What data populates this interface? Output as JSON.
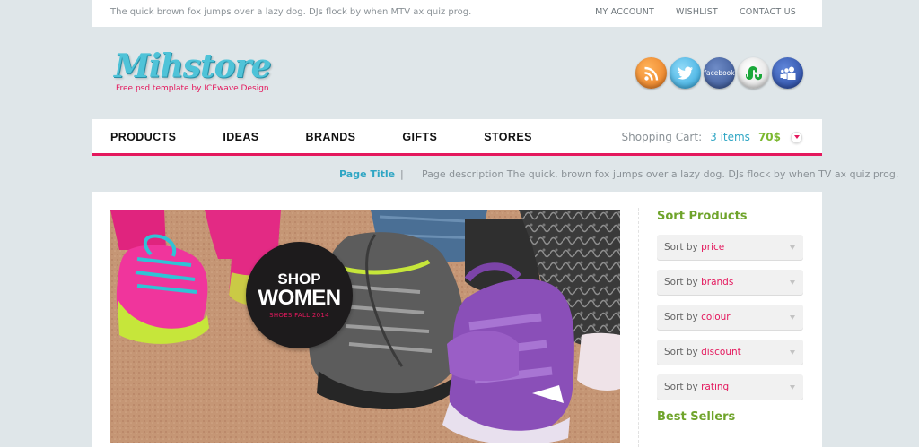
{
  "topbar": {
    "tagline": "The quick brown fox jumps over a lazy dog. DJs flock by when MTV ax quiz prog.",
    "links": [
      "MY ACCOUNT",
      "WISHLIST",
      "CONTACT US"
    ]
  },
  "logo": {
    "wordmark": "Mihstore",
    "subtitle": "Free psd template by ICEwave Design"
  },
  "social": [
    {
      "name": "rss-icon",
      "label": ""
    },
    {
      "name": "twitter-icon",
      "label": ""
    },
    {
      "name": "facebook-icon",
      "label": "facebook"
    },
    {
      "name": "stumbleupon-icon",
      "label": ""
    },
    {
      "name": "myspace-icon",
      "label": ""
    }
  ],
  "nav": {
    "items": [
      "PRODUCTS",
      "IDEAS",
      "BRANDS",
      "GIFTS",
      "STORES"
    ],
    "cart_label": "Shopping Cart:",
    "cart_items": "3 items",
    "cart_price": "70$"
  },
  "page": {
    "title": "Page Title",
    "separator": "|",
    "description": "Page description The quick, brown fox jumps over a lazy dog. DJs flock by when TV ax quiz prog."
  },
  "hero": {
    "badge_top": "SHOP",
    "badge_main": "WOMEN",
    "badge_sub": "SHOES FALL 2014"
  },
  "sidebar": {
    "sort_title": "Sort Products",
    "sort_prefix": "Sort by",
    "sort_options": [
      "price",
      "brands",
      "colour",
      "discount",
      "rating"
    ],
    "best_title": "Best Sellers"
  },
  "colors": {
    "accent": "#e4185d",
    "teal": "#2fa6c4",
    "green": "#6fa42b",
    "background": "#dfe6e9"
  }
}
